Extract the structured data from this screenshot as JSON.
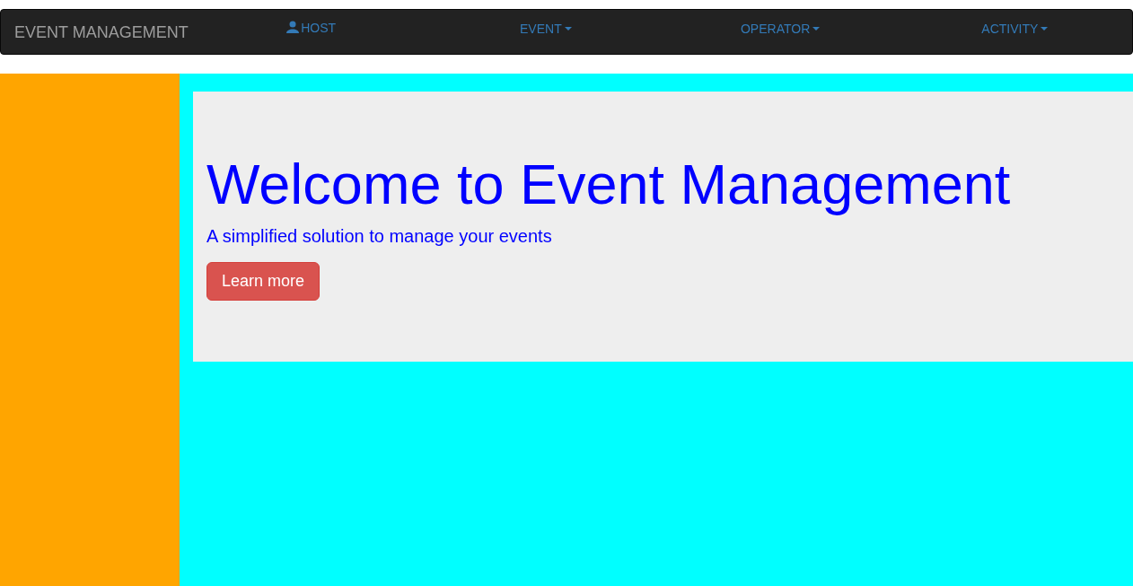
{
  "navbar": {
    "brand": "EVENT MANAGEMENT",
    "items": [
      {
        "label": "HOST",
        "kind": "icon-link"
      },
      {
        "label": "EVENT",
        "kind": "dropdown"
      },
      {
        "label": "OPERATOR",
        "kind": "dropdown"
      },
      {
        "label": "ACTIVITY",
        "kind": "dropdown"
      }
    ]
  },
  "jumbotron": {
    "title": "Welcome to Event Management",
    "subtitle": "A simplified solution to manage your events",
    "button": "Learn more"
  }
}
